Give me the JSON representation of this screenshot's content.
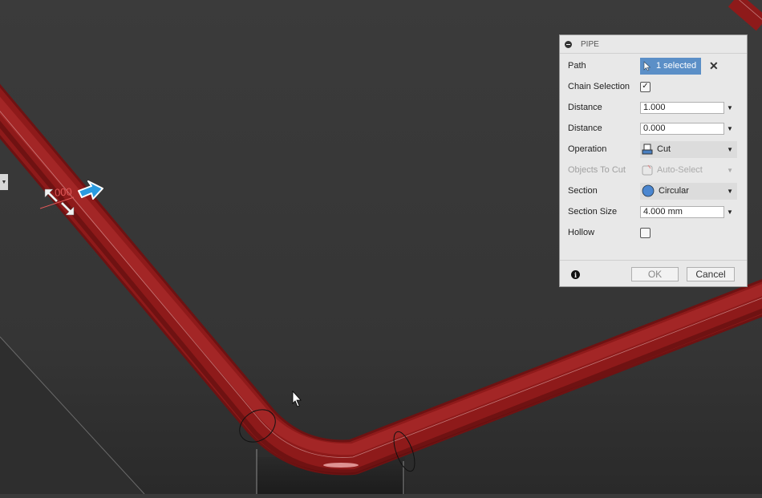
{
  "viewport": {
    "manipulator_value": "000",
    "colors": {
      "pipe": "#8e1a1a",
      "background": "#3a3a3a",
      "selection": "#5b8fc7"
    }
  },
  "dialog": {
    "title": "PIPE",
    "path": {
      "label": "Path",
      "value": "1 selected"
    },
    "chain_selection": {
      "label": "Chain Selection",
      "checked": true
    },
    "distance1": {
      "label": "Distance",
      "value": "1.000"
    },
    "distance2": {
      "label": "Distance",
      "value": "0.000"
    },
    "operation": {
      "label": "Operation",
      "value": "Cut"
    },
    "objects_to_cut": {
      "label": "Objects To Cut",
      "value": "Auto-Select"
    },
    "section": {
      "label": "Section",
      "value": "Circular"
    },
    "section_size": {
      "label": "Section Size",
      "value": "4.000 mm"
    },
    "hollow": {
      "label": "Hollow",
      "checked": false
    },
    "ok_label": "OK",
    "cancel_label": "Cancel"
  },
  "icons": {
    "close": "close-icon",
    "check": "✓",
    "dropdown": "▼",
    "info": "i"
  }
}
